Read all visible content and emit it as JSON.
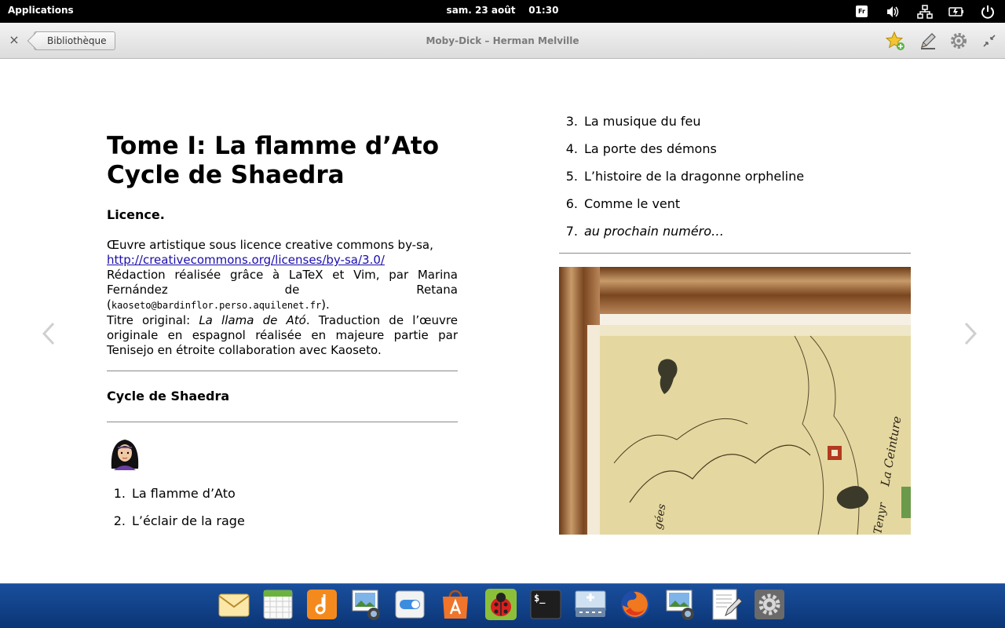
{
  "top_panel": {
    "applications_label": "Applications",
    "clock": "sam. 23 août    01:30",
    "keyboard_layout": "Fr"
  },
  "titlebar": {
    "back_label": "Bibliothèque",
    "title": "Moby-Dick – Herman Melville",
    "close_glyph": "×"
  },
  "book": {
    "title_line1": "Tome I: La flamme d’Ato",
    "title_line2": "Cycle de Shaedra",
    "licence_heading": "Licence.",
    "licence_text1": "Œuvre artistique sous licence creative commons by-sa,",
    "licence_link": "http://creativecommons.org/licenses/by-sa/3.0/",
    "licence_text2a": "Rédaction réalisée grâce à LaTeX et Vim, par Marina",
    "licence_name1": "Fernández",
    "licence_name2": "de",
    "licence_name3": "Retana",
    "licence_email": "kaoseto@bardinflor.perso.aquilenet.fr",
    "original_prefix": "Titre original: ",
    "original_title": "La llama de Ató",
    "original_rest": ". Traduction de l’œuvre originale en espagnol réalisée en majeure partie par Tenisejo en étroite collaboration avec Kaoseto.",
    "cycle_heading": "Cycle de Shaedra",
    "chapters": [
      {
        "num": "1.",
        "label": "La flamme d’Ato"
      },
      {
        "num": "2.",
        "label": "L’éclair de la rage"
      },
      {
        "num": "3.",
        "label": "La musique du feu"
      },
      {
        "num": "4.",
        "label": "La porte des démons"
      },
      {
        "num": "5.",
        "label": "L’histoire de la dragonne orpheline"
      },
      {
        "num": "6.",
        "label": "Comme le vent"
      },
      {
        "num": "7.",
        "label": "au prochain numéro…"
      }
    ],
    "map_labels": {
      "ceinture": "La Ceinture",
      "left": "gées",
      "bottom": "Tenyr"
    }
  },
  "dock": {
    "items": [
      "mail-icon",
      "calendar-icon",
      "music-icon",
      "photos-icon",
      "switchboard-icon",
      "app-center-icon",
      "bug-icon",
      "terminal-icon",
      "files-icon",
      "firefox-icon",
      "screenshot-icon",
      "text-editor-icon",
      "settings-icon"
    ],
    "terminal_glyph": "$_"
  },
  "colors": {
    "top_panel": "#000000",
    "dock": "#0b3576",
    "link": "#1a0dab"
  }
}
